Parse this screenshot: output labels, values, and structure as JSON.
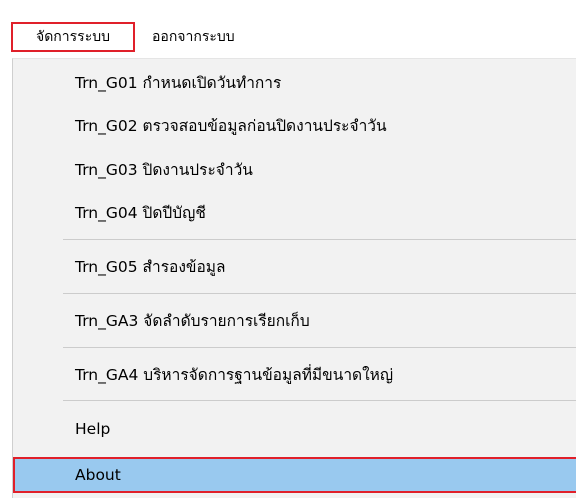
{
  "menubar": {
    "items": [
      {
        "label": "จัดการระบบ",
        "active": true
      },
      {
        "label": "ออกจากระบบ",
        "active": false
      }
    ]
  },
  "dropdown": {
    "items": [
      {
        "label": "Trn_G01 กำหนดเปิดวันทำการ"
      },
      {
        "label": "Trn_G02 ตรวจสอบข้อมูลก่อนปิดงานประจำวัน"
      },
      {
        "label": "Trn_G03 ปิดงานประจำวัน"
      },
      {
        "label": "Trn_G04 ปิดปีบัญชี"
      },
      {
        "label": "Trn_G05 สำรองข้อมูล"
      },
      {
        "label": "Trn_GA3 จัดลำดับรายการเรียกเก็บ"
      },
      {
        "label": "Trn_GA4 บริหารจัดการฐานข้อมูลที่มีขนาดใหญ่"
      },
      {
        "label": "Help"
      },
      {
        "label": "About",
        "highlighted": true
      }
    ]
  },
  "colors": {
    "highlight_bg": "#99c9ef",
    "annotation_border": "#e0202a",
    "menu_bg": "#f2f2f2"
  }
}
